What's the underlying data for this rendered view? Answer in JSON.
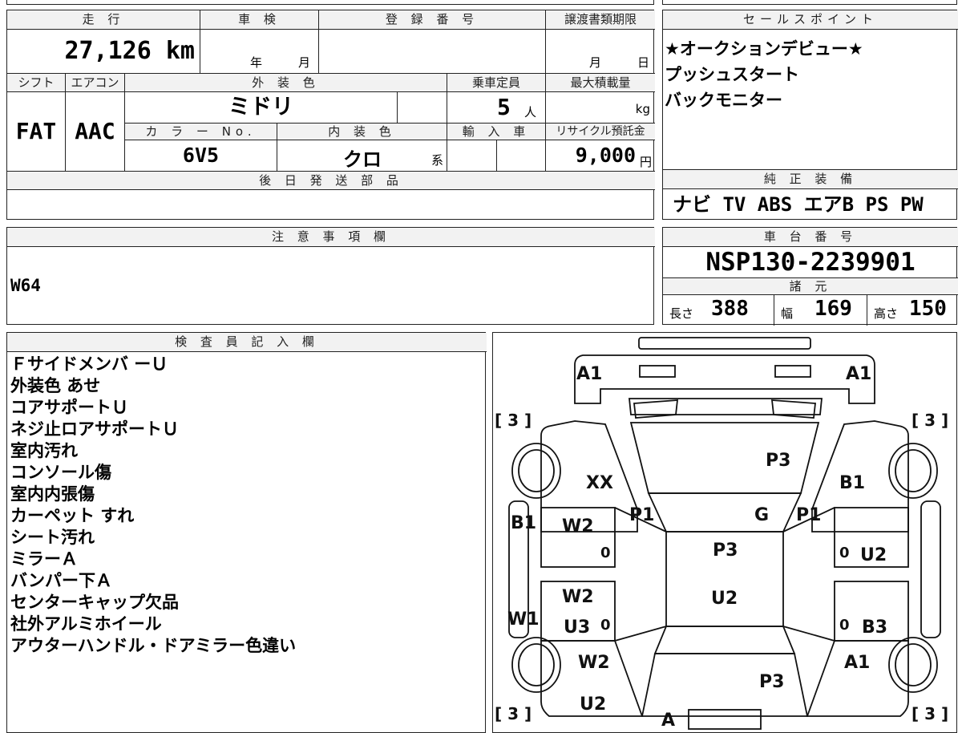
{
  "specs": {
    "mileage_label": "走 行",
    "mileage": "27,126 km",
    "inspection_label": "車 検",
    "year_unit": "年",
    "month_unit": "月",
    "reg_label": "登 録 番 号",
    "transfer_label": "譲渡書類期限",
    "transfer_month": "月",
    "transfer_day": "日",
    "shift_label": "シフト",
    "shift": "FAT",
    "ac_label": "エアコン",
    "ac": "AAC",
    "ext_color_label": "外 装 色",
    "ext_color": "ミドリ",
    "capacity_label": "乗車定員",
    "capacity": "5",
    "capacity_unit": "人",
    "max_load_label": "最大積載量",
    "max_load_unit": "kg",
    "color_no_label": "カ ラ ー No.",
    "color_no": "6V5",
    "int_color_label": "内 装 色",
    "int_color": "クロ",
    "int_color_unit": "系",
    "import_label": "輸 入 車",
    "recycle_label": "リサイクル預託金",
    "recycle": "9,000",
    "recycle_unit": "円",
    "later_parts_label": "後 日 発 送 部 品"
  },
  "sales": {
    "label": "セールスポイント",
    "lines": [
      "★オークションデビュー★",
      "プッシュスタート",
      "バックモニター"
    ]
  },
  "equipment": {
    "label": "純 正 装 備",
    "items": "ナビ TV ABS エアB PS PW"
  },
  "notes": {
    "label": "注 意 事 項 欄",
    "text": "W64"
  },
  "chassis": {
    "label": "車 台 番 号",
    "number": "NSP130-2239901",
    "dims_label": "諸 元",
    "length_label": "長さ",
    "length": "388",
    "width_label": "幅",
    "width": "169",
    "height_label": "高さ",
    "height": "150"
  },
  "inspector": {
    "label": "検 査 員 記 入 欄",
    "lines": [
      "Ｆサイドメンバ ーＵ",
      "外装色 あせ",
      "コアサポートＵ",
      "ネジ止ロアサポートＵ",
      "室内汚れ",
      "コンソール傷",
      "室内内張傷",
      "カーペット すれ",
      "シート汚れ",
      "ミラーＡ",
      "バンパー下Ａ",
      "センターキャップ欠品",
      "社外アルミホイール",
      "アウターハンドル・ドアミラー色違い"
    ]
  },
  "diagram": {
    "marks": {
      "a1_left": "A1",
      "a1_right": "A1",
      "tread_fl": "[ 3 ]",
      "tread_fr": "[ 3 ]",
      "tread_rl": "[ 3 ]",
      "tread_rr": "[ 3 ]",
      "xx": "XX",
      "p3_hood": "P3",
      "b1_right": "B1",
      "b1_left": "B1",
      "w2_fl": "W2",
      "p1_left": "P1",
      "g": "G",
      "p1_right": "P1",
      "p3_roof": "P3",
      "u2_fr": "U2",
      "w2_rl": "W2",
      "u2_center": "U2",
      "w1": "W1",
      "u3": "U3",
      "b3": "B3",
      "w2_rear": "W2",
      "a1_rear": "A1",
      "p3_trunk": "P3",
      "u2_rear": "U2",
      "a_bottom": "A",
      "zero1": "0",
      "zero2": "0",
      "zero3": "0",
      "zero4": "0"
    }
  }
}
